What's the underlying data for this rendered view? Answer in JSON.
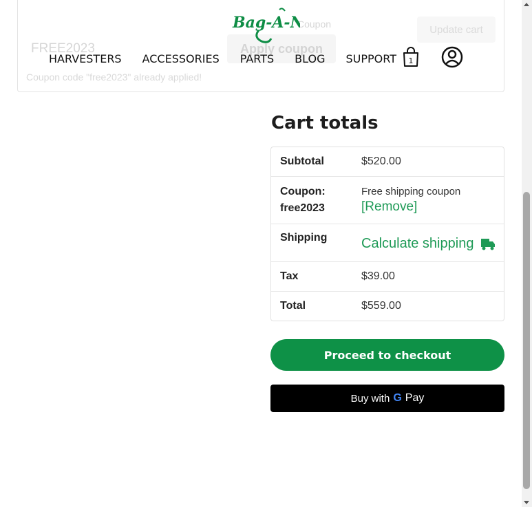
{
  "coupon_form": {
    "input_value": "FREE2023",
    "label": "Coupon",
    "apply_label": "Apply coupon",
    "update_label": "Update cart",
    "notice": "Coupon code \"free2023\" already applied!"
  },
  "header": {
    "logo_text": "Bag-A-Nut",
    "nav": [
      "HARVESTERS",
      "ACCESSORIES",
      "PARTS",
      "BLOG",
      "SUPPORT"
    ],
    "cart_count": "1",
    "icons": {
      "cart": "shopping-bag-icon",
      "account": "account-icon"
    }
  },
  "cart_totals": {
    "title": "Cart totals",
    "subtotal_label": "Subtotal",
    "subtotal_value": "$520.00",
    "coupon_label": "Coupon: free2023",
    "coupon_value": "Free shipping coupon",
    "remove_label": "[Remove]",
    "shipping_label": "Shipping",
    "calc_shipping_label": "Calculate shipping",
    "tax_label": "Tax",
    "tax_value": "$39.00",
    "total_label": "Total",
    "total_value": "$559.00"
  },
  "buttons": {
    "checkout_label": "Proceed to checkout",
    "gpay_prefix": "Buy with",
    "gpay_g": "G",
    "gpay_pay": "Pay"
  },
  "colors": {
    "brand_green": "#0e9147",
    "link_green": "#1e9a56"
  }
}
